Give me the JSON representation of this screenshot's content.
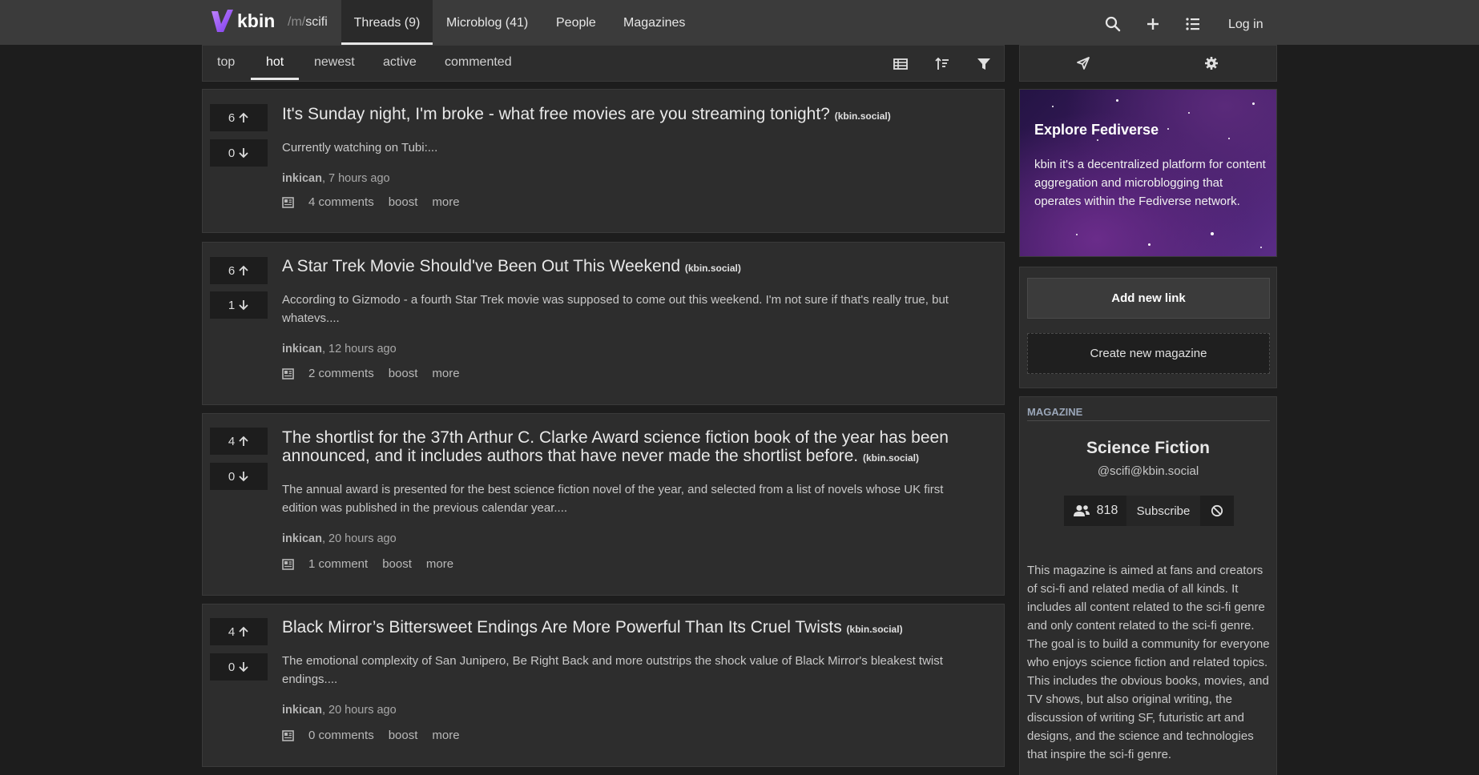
{
  "header": {
    "logo_text": "kbin",
    "magazine_prefix": "/m/",
    "magazine_name": "scifi",
    "tabs": [
      {
        "label": "Threads (9)"
      },
      {
        "label": "Microblog (41)"
      },
      {
        "label": "People"
      },
      {
        "label": "Magazines"
      }
    ],
    "icons": [
      "search-icon",
      "plus-icon",
      "list-icon"
    ],
    "login_label": "Log in"
  },
  "sort": {
    "options": [
      "top",
      "hot",
      "newest",
      "active",
      "commented"
    ],
    "selected": "hot",
    "icons": [
      "table-view-icon",
      "sort-icon",
      "filter-icon"
    ]
  },
  "posts": [
    {
      "up": "6",
      "down": "0",
      "title": "It's Sunday night, I'm broke - what free movies are you streaming tonight?",
      "domain": "(kbin.social)",
      "body": "Currently watching on Tubi:...",
      "author": "inkican",
      "time": ", 7 hours ago",
      "comments": "4 comments",
      "boost": "boost",
      "more": "more"
    },
    {
      "up": "6",
      "down": "1",
      "title": "A Star Trek Movie Should've Been Out This Weekend",
      "domain": "(kbin.social)",
      "body": "According to Gizmodo - a fourth Star Trek movie was supposed to come out this weekend. I'm not sure if that's really true, but whatevs....",
      "author": "inkican",
      "time": ", 12 hours ago",
      "comments": "2 comments",
      "boost": "boost",
      "more": "more"
    },
    {
      "up": "4",
      "down": "0",
      "title": "The shortlist for the 37th Arthur C. Clarke Award science fiction book of the year has been announced, and it includes authors that have never made the shortlist before.",
      "domain": "(kbin.social)",
      "body": "The annual award is presented for the best science fiction novel of the year, and selected from a list of novels whose UK first edition was published in the previous calendar year....",
      "author": "inkican",
      "time": ", 20 hours ago",
      "comments": "1 comment",
      "boost": "boost",
      "more": "more"
    },
    {
      "up": "4",
      "down": "0",
      "title": "Black Mirror’s Bittersweet Endings Are More Powerful Than Its Cruel Twists",
      "domain": "(kbin.social)",
      "body": "The emotional complexity of San Junipero, Be Right Back and more outstrips the shock value of Black Mirror's bleakest twist endings....",
      "author": "inkican",
      "time": ", 20 hours ago",
      "comments": "0 comments",
      "boost": "boost",
      "more": "more"
    }
  ],
  "sidebar": {
    "tab_icons": [
      "send-icon",
      "gear-icon"
    ],
    "explore": {
      "title": "Explore Fediverse",
      "text": "kbin it's a decentralized platform for content aggregation and microblogging that operates within the Fediverse network."
    },
    "add_link_label": "Add new link",
    "create_magazine_label": "Create new magazine",
    "magazine": {
      "heading": "MAGAZINE",
      "name": "Science Fiction",
      "handle": "@scifi@kbin.social",
      "subscribers": "818",
      "subscribe_label": "Subscribe",
      "description": "This magazine is aimed at fans and creators of sci-fi and related media of all kinds. It includes all content related to the sci-fi genre and only content related to the sci-fi genre. The goal is to build a community for everyone who enjoys science fiction and related topics. This includes the obvious books, movies, and TV shows, but also original writing, the discussion of writing SF, futuristic art and designs, and the science and technologies that inspire the sci-fi genre."
    }
  },
  "colors": {
    "background": "#1d1d1d",
    "header": "#3b3b3b",
    "panel": "#2d2d2d",
    "logo_purple": "#a855f7"
  }
}
